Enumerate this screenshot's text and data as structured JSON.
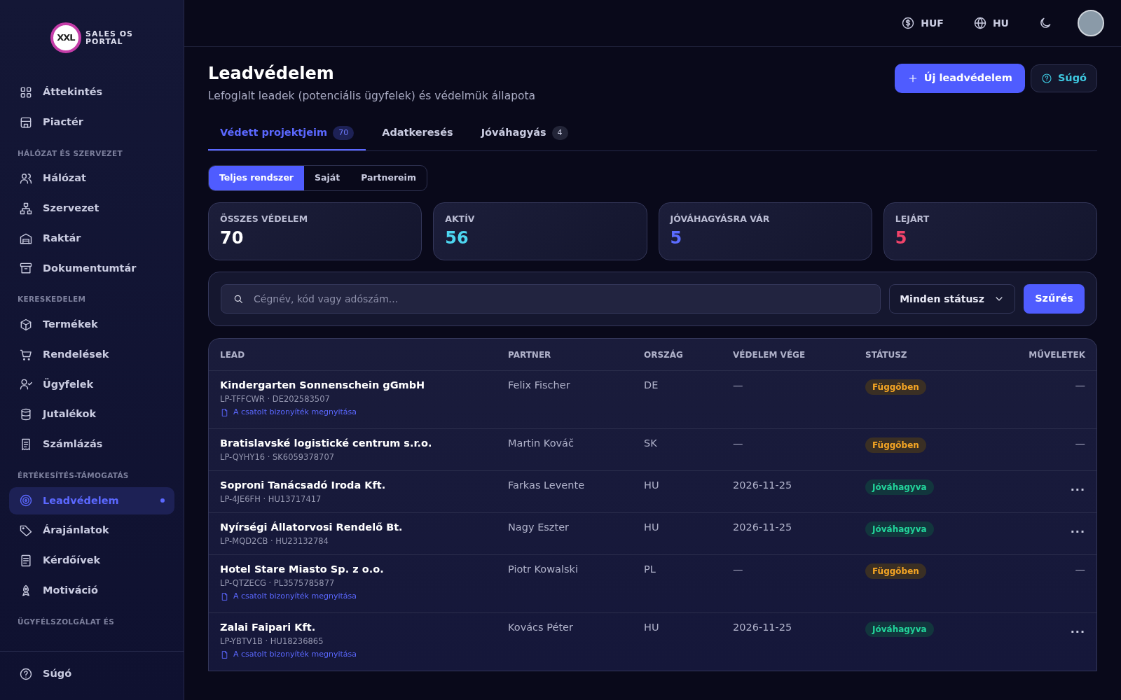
{
  "logo": {
    "mark": "XXL",
    "line1": "SALES OS",
    "line2": "PORTAL"
  },
  "sidebar": {
    "groups": [
      {
        "items": [
          {
            "label": "Áttekintés",
            "selected": false
          },
          {
            "label": "Piactér",
            "selected": false
          }
        ]
      },
      {
        "label": "HÁLÓZAT ÉS SZERVEZET",
        "items": [
          {
            "label": "Hálózat",
            "selected": false
          },
          {
            "label": "Szervezet",
            "selected": false
          },
          {
            "label": "Raktár",
            "selected": false
          },
          {
            "label": "Dokumentumtár",
            "selected": false
          }
        ]
      },
      {
        "label": "KERESKEDELEM",
        "items": [
          {
            "label": "Termékek",
            "selected": false
          },
          {
            "label": "Rendelések",
            "selected": false
          },
          {
            "label": "Ügyfelek",
            "selected": false
          },
          {
            "label": "Jutalékok",
            "selected": false
          },
          {
            "label": "Számlázás",
            "selected": false
          }
        ]
      },
      {
        "label": "ÉRTÉKESÍTÉS-TÁMOGATÁS",
        "items": [
          {
            "label": "Leadvédelem",
            "selected": true
          },
          {
            "label": "Árajánlatok",
            "selected": false
          },
          {
            "label": "Kérdőívek",
            "selected": false
          },
          {
            "label": "Motiváció",
            "selected": false
          }
        ]
      },
      {
        "label": "ÜGYFÉLSZOLGÁLAT ÉS"
      }
    ],
    "footer": {
      "label": "Súgó"
    }
  },
  "topbar": {
    "currency": "HUF",
    "language": "HU",
    "dark_mode": true
  },
  "page": {
    "title": "Leadvédelem",
    "subtitle": "Lefoglalt leadek (potenciális ügyfelek) és védelmük állapota",
    "primary_button": "Új leadvédelem",
    "help_button": "Súgó"
  },
  "tabs": [
    {
      "label": "Védett projektjeim",
      "count": "70",
      "selected": true
    },
    {
      "label": "Adatkeresés",
      "selected": false
    },
    {
      "label": "Jóváhagyás",
      "count": "4",
      "selected": false
    }
  ],
  "scope": [
    {
      "label": "Teljes rendszer",
      "selected": true
    },
    {
      "label": "Saját",
      "selected": false
    },
    {
      "label": "Partnereim",
      "selected": false
    }
  ],
  "stats": [
    {
      "label": "ÖSSZES VÉDELEM",
      "value": "70",
      "color": "#ffffff"
    },
    {
      "label": "AKTÍV",
      "value": "56",
      "color": "#4dd6f0"
    },
    {
      "label": "JÓVÁHAGYÁSRA VÁR",
      "value": "5",
      "color": "#5b6cff"
    },
    {
      "label": "LEJÁRT",
      "value": "5",
      "color": "#f0436a"
    }
  ],
  "filter": {
    "placeholder": "Cégnév, kód vagy adószám...",
    "status": "Minden státusz",
    "button": "Szűrés"
  },
  "table": {
    "columns": [
      "LEAD",
      "PARTNER",
      "ORSZÁG",
      "VÉDELEM VÉGE",
      "STÁTUSZ",
      "MŰVELETEK"
    ],
    "rows": [
      {
        "name": "Kindergarten Sonnenschein gGmbH",
        "code": "LP-TFFCWR · DE202583507",
        "attachment": "A csatolt bizonyíték megnyitása",
        "partner": "Felix Fischer",
        "country": "DE",
        "end": "—",
        "status": {
          "label": "Függőben",
          "kind": "pending"
        },
        "action": {
          "kind": "none",
          "text": "—"
        }
      },
      {
        "name": "Bratislavské logistické centrum s.r.o.",
        "code": "LP-QYHY16 · SK6059378707",
        "attachment": null,
        "partner": "Martin Kováč",
        "country": "SK",
        "end": "—",
        "status": {
          "label": "Függőben",
          "kind": "pending"
        },
        "action": {
          "kind": "none",
          "text": "—"
        }
      },
      {
        "name": "Soproni Tanácsadó Iroda Kft.",
        "code": "LP-4JE6FH · HU13717417",
        "attachment": null,
        "partner": "Farkas Levente",
        "country": "HU",
        "end": "2026-11-25",
        "status": {
          "label": "Jóváhagyva",
          "kind": "approved"
        },
        "action": {
          "kind": "menu",
          "text": "..."
        }
      },
      {
        "name": "Nyírségi Állatorvosi Rendelő Bt.",
        "code": "LP-MQD2CB · HU23132784",
        "attachment": null,
        "partner": "Nagy Eszter",
        "country": "HU",
        "end": "2026-11-25",
        "status": {
          "label": "Jóváhagyva",
          "kind": "approved"
        },
        "action": {
          "kind": "menu",
          "text": "..."
        }
      },
      {
        "name": "Hotel Stare Miasto Sp. z o.o.",
        "code": "LP-QTZECG · PL3575785877",
        "attachment": "A csatolt bizonyíték megnyitása",
        "partner": "Piotr Kowalski",
        "country": "PL",
        "end": "—",
        "status": {
          "label": "Függőben",
          "kind": "pending"
        },
        "action": {
          "kind": "none",
          "text": "—"
        }
      },
      {
        "name": "Zalai Faipari Kft.",
        "code": "LP-YBTV1B · HU18236865",
        "attachment": "A csatolt bizonyíték megnyitása",
        "partner": "Kovács Péter",
        "country": "HU",
        "end": "2026-11-25",
        "status": {
          "label": "Jóváhagyva",
          "kind": "approved"
        },
        "action": {
          "kind": "menu",
          "text": "..."
        }
      }
    ]
  }
}
